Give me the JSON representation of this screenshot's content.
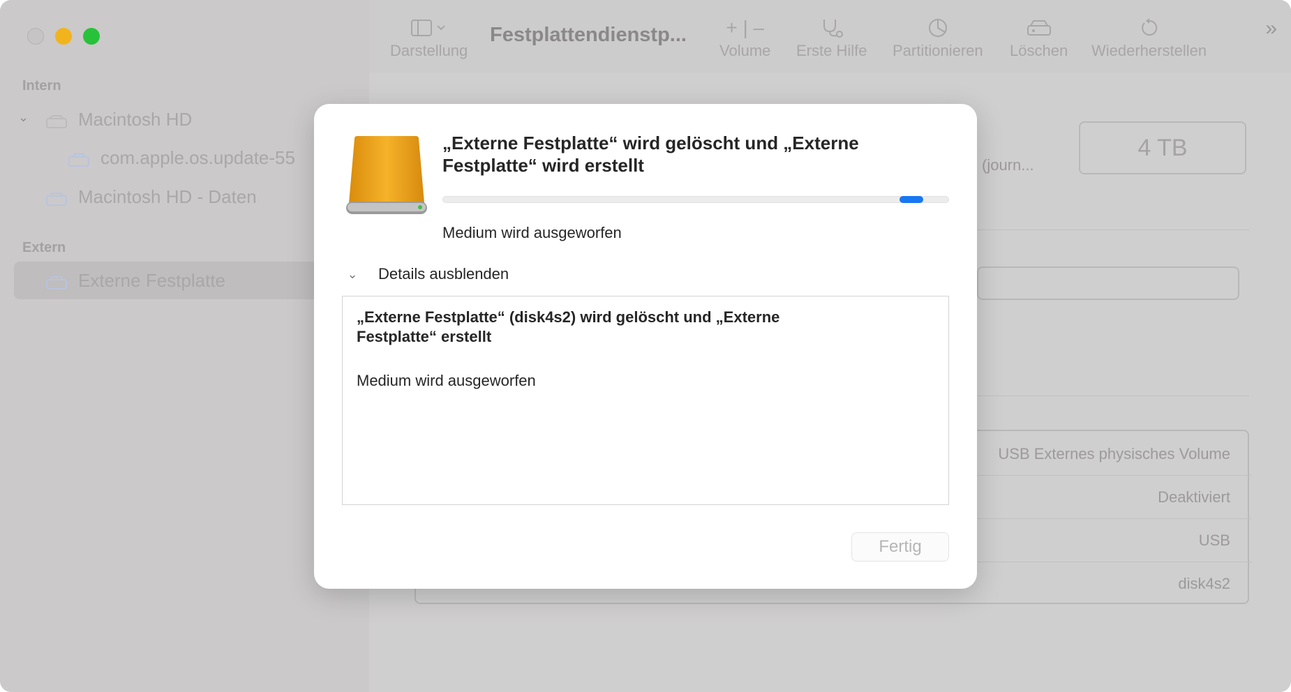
{
  "window": {
    "controls": [
      "close",
      "minimize",
      "maximize"
    ]
  },
  "sidebar": {
    "sections": [
      {
        "title": "Intern",
        "items": [
          {
            "label": "Macintosh HD",
            "icon": "internal-disk-icon"
          },
          {
            "label": "com.apple.os.update-55",
            "icon": "volume-icon"
          },
          {
            "label": "Macintosh HD - Daten",
            "icon": "volume-icon"
          }
        ]
      },
      {
        "title": "Extern",
        "items": [
          {
            "label": "Externe Festplatte",
            "icon": "external-disk-icon",
            "selected": true
          }
        ]
      }
    ]
  },
  "toolbar": {
    "title": "Festplattendienstp...",
    "view_label": "Darstellung",
    "volume_label": "Volume",
    "first_aid_label": "Erste Hilfe",
    "partition_label": "Partitionieren",
    "erase_label": "Löschen",
    "restore_label": "Wiederherstellen"
  },
  "background": {
    "capacity": "4 TB",
    "format_partial": "l (journ...",
    "info_rows": [
      "USB Externes physisches Volume",
      "Deaktiviert",
      "USB",
      "disk4s2"
    ]
  },
  "dialog": {
    "title": "„Externe Festplatte“ wird gelöscht und „Externe Festplatte“ wird erstellt",
    "progress": 0.95,
    "status": "Medium wird ausgeworfen",
    "details_toggle_label": "Details ausblenden",
    "log": {
      "line1": "„Externe Festplatte“ (disk4s2) wird gelöscht und „Externe Festplatte“ erstellt",
      "line2": "Medium wird ausgeworfen"
    },
    "done_label": "Fertig"
  },
  "colors": {
    "accent": "#1877f2",
    "close": "#c6c4c4",
    "minimize": "#f2b41c",
    "maximize": "#27c23a",
    "drive": "#f0a318"
  }
}
